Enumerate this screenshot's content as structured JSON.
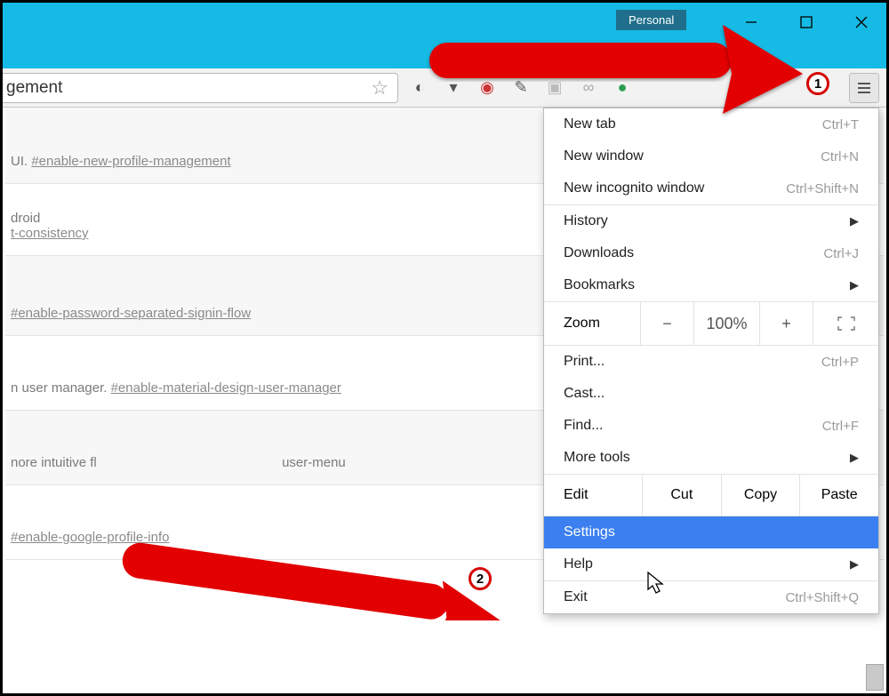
{
  "window": {
    "profile_badge": "Personal"
  },
  "omnibox": {
    "text": "gement"
  },
  "flags": {
    "row0_text": "UI. ",
    "row0_link": "#enable-new-profile-management",
    "row1_line1": "droid",
    "row1_link": "t-consistency",
    "row2_link": "#enable-password-separated-signin-flow",
    "row3_text": "n user manager. ",
    "row3_link": "#enable-material-design-user-manager",
    "row4_text": "nore intuitive fl",
    "row4_text2": "user-menu",
    "row5_link": "#enable-google-profile-info"
  },
  "menu": {
    "new_tab": "New tab",
    "new_tab_sc": "Ctrl+T",
    "new_window": "New window",
    "new_window_sc": "Ctrl+N",
    "new_incog": "New incognito window",
    "new_incog_sc": "Ctrl+Shift+N",
    "history": "History",
    "downloads": "Downloads",
    "downloads_sc": "Ctrl+J",
    "bookmarks": "Bookmarks",
    "zoom": "Zoom",
    "zoom_value": "100%",
    "print": "Print...",
    "print_sc": "Ctrl+P",
    "cast": "Cast...",
    "find": "Find...",
    "find_sc": "Ctrl+F",
    "more_tools": "More tools",
    "edit": "Edit",
    "cut": "Cut",
    "copy": "Copy",
    "paste": "Paste",
    "settings": "Settings",
    "help": "Help",
    "exit": "Exit",
    "exit_sc": "Ctrl+Shift+Q"
  },
  "callouts": {
    "one": "1",
    "two": "2"
  }
}
